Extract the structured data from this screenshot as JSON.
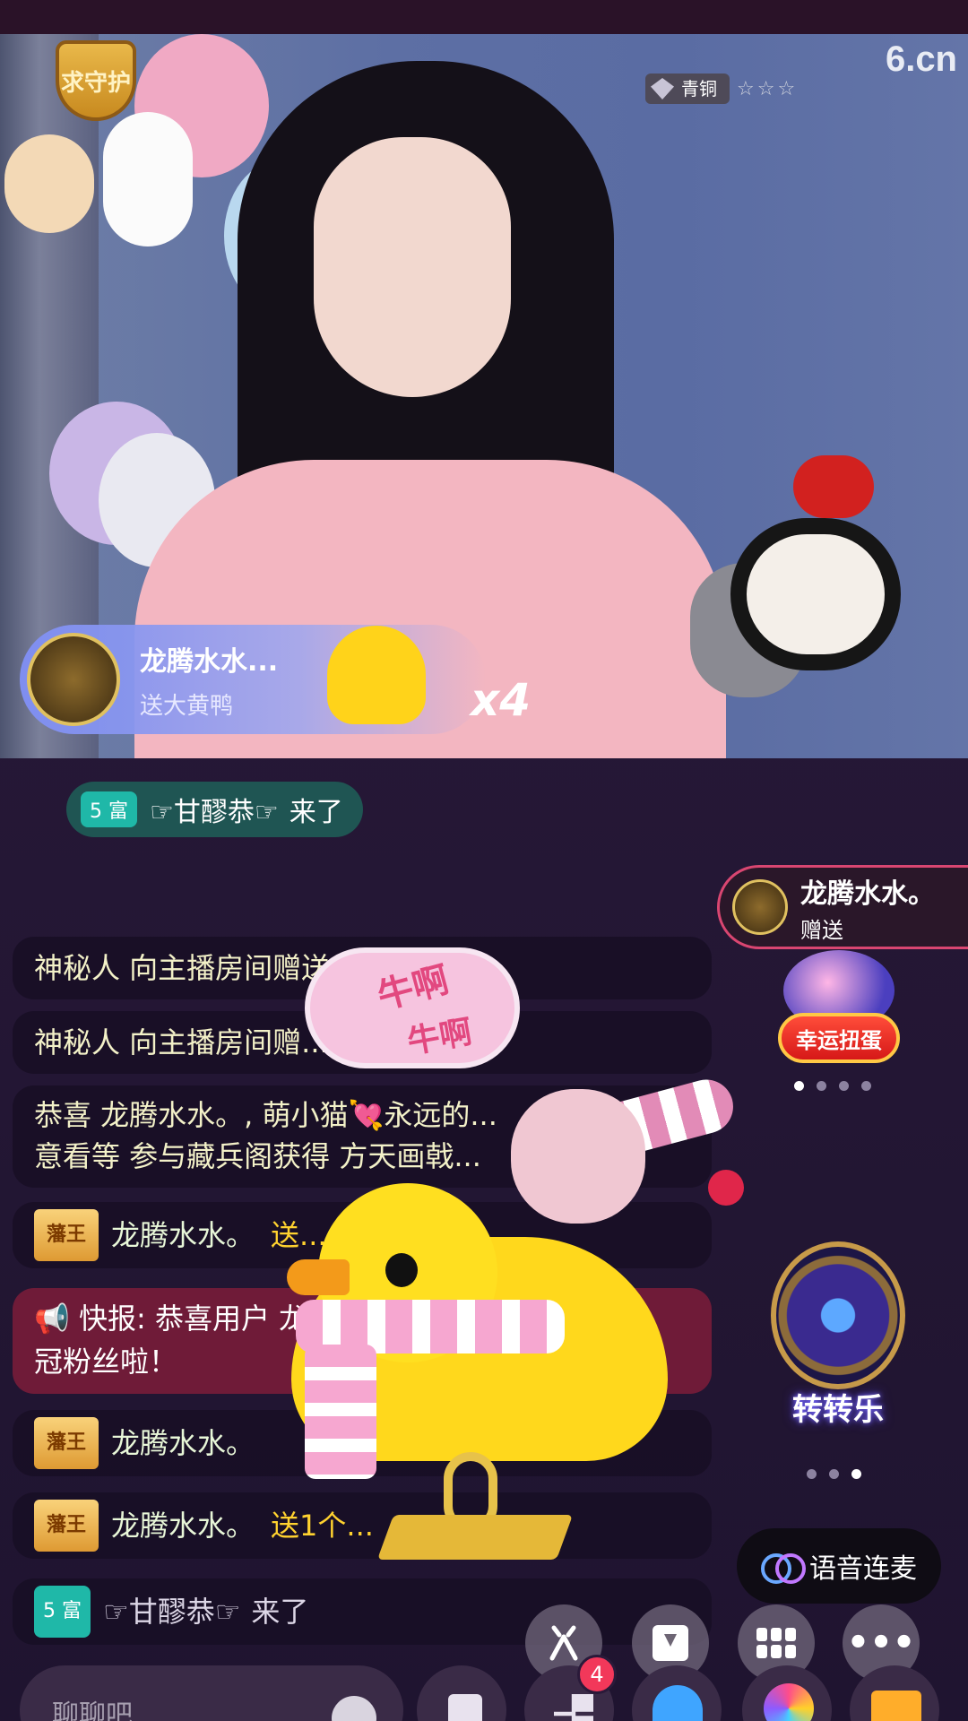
{
  "watermark": "6.cn",
  "guard_badge": "求守护",
  "anchor_rank": {
    "tier": "青铜",
    "stars": "☆☆☆"
  },
  "gift_banner": {
    "user": "龙腾水水...",
    "action": "送大黄鸭",
    "count": "x4"
  },
  "enter_notice": {
    "level": "5 富",
    "user": "☞甘醪恭☞",
    "action": "来了"
  },
  "recv_card": {
    "user": "龙腾水水。",
    "action": "赠送"
  },
  "gacha": {
    "label": "幸运扭蛋",
    "dots": 4,
    "active_dot": 0
  },
  "spin": {
    "label": "转转乐",
    "dots": 3,
    "active_dot": 2
  },
  "bubble": {
    "line1": "牛啊",
    "line2": "牛啊"
  },
  "chat": {
    "m1": "神秘人 向主播房间赠送... 滴！",
    "m2": "神秘人 向主播房间赠... 滴！",
    "m3_line1": "恭喜 龙腾水水。, 萌小猫💘永远的...",
    "m3_line2": "意看等 参与藏兵阁获得 方天画戟...",
    "m4_badge": "藩王",
    "m4_user": "龙腾水水。",
    "m4_action": "送...",
    "m5_line1": "📢 快报: 恭喜用户 龙...",
    "m5_line2": "冠粉丝啦！",
    "m6_badge": "藩王",
    "m6_user": "龙腾水水。",
    "m7_badge": "藩王",
    "m7_user": "龙腾水水。",
    "m7_action": "送1个...",
    "m8_level": "5 富",
    "m8_user": "☞甘醪恭☞",
    "m8_action": "来了"
  },
  "voice_button": "语音连麦",
  "notification_count": "4",
  "input_placeholder": "聊聊吧",
  "colors": {
    "accent": "#d94671",
    "gift_text": "#ffd22f",
    "level_chip": "#1fb8a8"
  },
  "icons": [
    "six-logo-icon",
    "download-icon",
    "apps-icon",
    "more-icon",
    "emoji-icon",
    "gift-icon",
    "voice-link-icon"
  ]
}
